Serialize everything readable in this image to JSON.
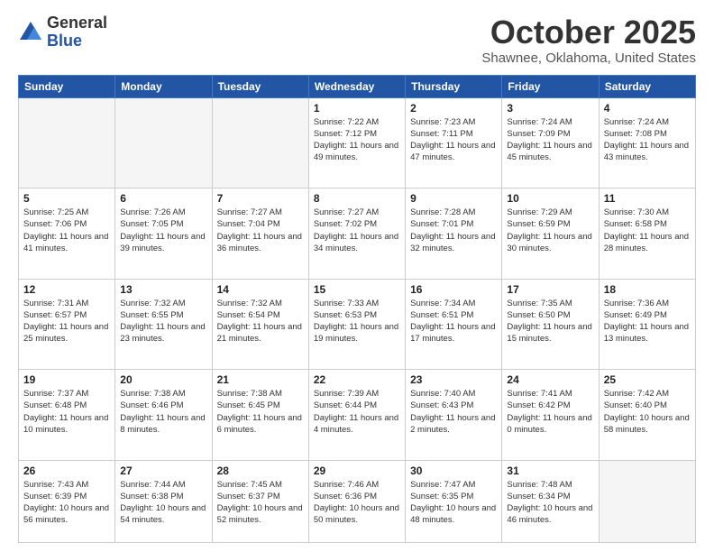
{
  "header": {
    "logo": {
      "general": "General",
      "blue": "Blue"
    },
    "title": "October 2025",
    "subtitle": "Shawnee, Oklahoma, United States"
  },
  "weekdays": [
    "Sunday",
    "Monday",
    "Tuesday",
    "Wednesday",
    "Thursday",
    "Friday",
    "Saturday"
  ],
  "weeks": [
    [
      {
        "day": "",
        "info": ""
      },
      {
        "day": "",
        "info": ""
      },
      {
        "day": "",
        "info": ""
      },
      {
        "day": "1",
        "info": "Sunrise: 7:22 AM\nSunset: 7:12 PM\nDaylight: 11 hours\nand 49 minutes."
      },
      {
        "day": "2",
        "info": "Sunrise: 7:23 AM\nSunset: 7:11 PM\nDaylight: 11 hours\nand 47 minutes."
      },
      {
        "day": "3",
        "info": "Sunrise: 7:24 AM\nSunset: 7:09 PM\nDaylight: 11 hours\nand 45 minutes."
      },
      {
        "day": "4",
        "info": "Sunrise: 7:24 AM\nSunset: 7:08 PM\nDaylight: 11 hours\nand 43 minutes."
      }
    ],
    [
      {
        "day": "5",
        "info": "Sunrise: 7:25 AM\nSunset: 7:06 PM\nDaylight: 11 hours\nand 41 minutes."
      },
      {
        "day": "6",
        "info": "Sunrise: 7:26 AM\nSunset: 7:05 PM\nDaylight: 11 hours\nand 39 minutes."
      },
      {
        "day": "7",
        "info": "Sunrise: 7:27 AM\nSunset: 7:04 PM\nDaylight: 11 hours\nand 36 minutes."
      },
      {
        "day": "8",
        "info": "Sunrise: 7:27 AM\nSunset: 7:02 PM\nDaylight: 11 hours\nand 34 minutes."
      },
      {
        "day": "9",
        "info": "Sunrise: 7:28 AM\nSunset: 7:01 PM\nDaylight: 11 hours\nand 32 minutes."
      },
      {
        "day": "10",
        "info": "Sunrise: 7:29 AM\nSunset: 6:59 PM\nDaylight: 11 hours\nand 30 minutes."
      },
      {
        "day": "11",
        "info": "Sunrise: 7:30 AM\nSunset: 6:58 PM\nDaylight: 11 hours\nand 28 minutes."
      }
    ],
    [
      {
        "day": "12",
        "info": "Sunrise: 7:31 AM\nSunset: 6:57 PM\nDaylight: 11 hours\nand 25 minutes."
      },
      {
        "day": "13",
        "info": "Sunrise: 7:32 AM\nSunset: 6:55 PM\nDaylight: 11 hours\nand 23 minutes."
      },
      {
        "day": "14",
        "info": "Sunrise: 7:32 AM\nSunset: 6:54 PM\nDaylight: 11 hours\nand 21 minutes."
      },
      {
        "day": "15",
        "info": "Sunrise: 7:33 AM\nSunset: 6:53 PM\nDaylight: 11 hours\nand 19 minutes."
      },
      {
        "day": "16",
        "info": "Sunrise: 7:34 AM\nSunset: 6:51 PM\nDaylight: 11 hours\nand 17 minutes."
      },
      {
        "day": "17",
        "info": "Sunrise: 7:35 AM\nSunset: 6:50 PM\nDaylight: 11 hours\nand 15 minutes."
      },
      {
        "day": "18",
        "info": "Sunrise: 7:36 AM\nSunset: 6:49 PM\nDaylight: 11 hours\nand 13 minutes."
      }
    ],
    [
      {
        "day": "19",
        "info": "Sunrise: 7:37 AM\nSunset: 6:48 PM\nDaylight: 11 hours\nand 10 minutes."
      },
      {
        "day": "20",
        "info": "Sunrise: 7:38 AM\nSunset: 6:46 PM\nDaylight: 11 hours\nand 8 minutes."
      },
      {
        "day": "21",
        "info": "Sunrise: 7:38 AM\nSunset: 6:45 PM\nDaylight: 11 hours\nand 6 minutes."
      },
      {
        "day": "22",
        "info": "Sunrise: 7:39 AM\nSunset: 6:44 PM\nDaylight: 11 hours\nand 4 minutes."
      },
      {
        "day": "23",
        "info": "Sunrise: 7:40 AM\nSunset: 6:43 PM\nDaylight: 11 hours\nand 2 minutes."
      },
      {
        "day": "24",
        "info": "Sunrise: 7:41 AM\nSunset: 6:42 PM\nDaylight: 11 hours\nand 0 minutes."
      },
      {
        "day": "25",
        "info": "Sunrise: 7:42 AM\nSunset: 6:40 PM\nDaylight: 10 hours\nand 58 minutes."
      }
    ],
    [
      {
        "day": "26",
        "info": "Sunrise: 7:43 AM\nSunset: 6:39 PM\nDaylight: 10 hours\nand 56 minutes."
      },
      {
        "day": "27",
        "info": "Sunrise: 7:44 AM\nSunset: 6:38 PM\nDaylight: 10 hours\nand 54 minutes."
      },
      {
        "day": "28",
        "info": "Sunrise: 7:45 AM\nSunset: 6:37 PM\nDaylight: 10 hours\nand 52 minutes."
      },
      {
        "day": "29",
        "info": "Sunrise: 7:46 AM\nSunset: 6:36 PM\nDaylight: 10 hours\nand 50 minutes."
      },
      {
        "day": "30",
        "info": "Sunrise: 7:47 AM\nSunset: 6:35 PM\nDaylight: 10 hours\nand 48 minutes."
      },
      {
        "day": "31",
        "info": "Sunrise: 7:48 AM\nSunset: 6:34 PM\nDaylight: 10 hours\nand 46 minutes."
      },
      {
        "day": "",
        "info": ""
      }
    ]
  ]
}
